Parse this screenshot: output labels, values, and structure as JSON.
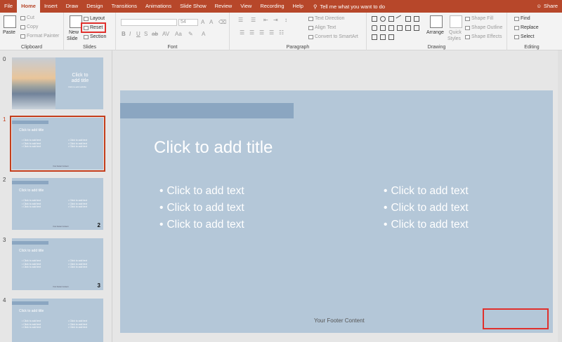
{
  "tabs": [
    "File",
    "Home",
    "Insert",
    "Draw",
    "Design",
    "Transitions",
    "Animations",
    "Slide Show",
    "Review",
    "View",
    "Recording",
    "Help"
  ],
  "tell_me": "Tell me what you want to do",
  "share": "Share",
  "ribbon": {
    "clipboard": {
      "label": "Clipboard",
      "paste": "Paste",
      "cut": "Cut",
      "copy": "Copy",
      "format_painter": "Format Painter"
    },
    "slides": {
      "label": "Slides",
      "new_slide": "New",
      "new_slide2": "Slide",
      "layout": "Layout",
      "reset": "Reset",
      "section": "Section"
    },
    "font": {
      "label": "Font",
      "size": "54"
    },
    "paragraph": {
      "label": "Paragraph",
      "text_direction": "Text Direction",
      "align_text": "Align Text",
      "convert": "Convert to SmartArt"
    },
    "drawing": {
      "label": "Drawing",
      "arrange": "Arrange",
      "quick_styles": "Quick",
      "quick_styles2": "Styles",
      "shape_fill": "Shape Fill",
      "shape_outline": "Shape Outline",
      "shape_effects": "Shape Effects"
    },
    "editing": {
      "label": "Editing",
      "find": "Find",
      "replace": "Replace",
      "select": "Select"
    }
  },
  "thumbnails": [
    {
      "num": "0",
      "title_line1": "Click to",
      "title_line2": "add title",
      "subtitle": "Click to add subtitle"
    },
    {
      "num": "1",
      "title": "Click to add title",
      "bullet": "• Click to add text",
      "footer": "Your Footer Content",
      "page": ""
    },
    {
      "num": "2",
      "title": "Click to add title",
      "bullet": "• Click to add text",
      "footer": "Your Footer Content",
      "page": "2"
    },
    {
      "num": "3",
      "title": "Click to add title",
      "bullet": "• Click to add text",
      "footer": "Your Footer Content",
      "page": "3"
    },
    {
      "num": "4",
      "title": "Click to add title",
      "bullet": "• Click to add text",
      "footer": "",
      "page": ""
    }
  ],
  "slide": {
    "title": "Click to add title",
    "left_bullets": [
      "Click to add text",
      "Click to add text",
      "Click to add text"
    ],
    "right_bullets": [
      "Click to add text",
      "Click to add text",
      "Click to add text"
    ],
    "footer": "Your Footer Content"
  },
  "colors": {
    "accent": "#b7472a",
    "slide_bg": "#b4c7d8",
    "highlight": "#e0302c"
  }
}
